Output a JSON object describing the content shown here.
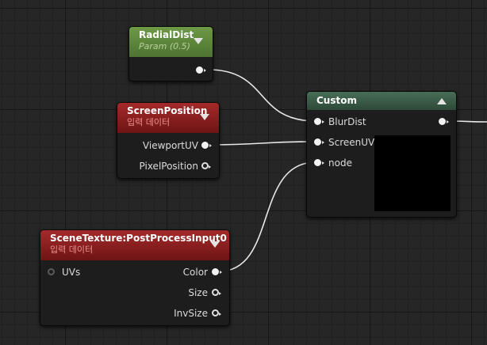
{
  "nodes": {
    "radial_dist": {
      "title": "RadialDist",
      "subtitle": "Param (0.5)"
    },
    "screen_position": {
      "title": "ScreenPosition",
      "subtitle": "입력 데이터",
      "outputs": [
        "ViewportUV",
        "PixelPosition"
      ]
    },
    "custom": {
      "title": "Custom",
      "inputs": [
        "BlurDist",
        "ScreenUV",
        "node"
      ]
    },
    "scene_texture": {
      "title": "SceneTexture:PostProcessInput0",
      "subtitle": "입력 데이터",
      "inputs": [
        "UVs"
      ],
      "outputs": [
        "Color",
        "Size",
        "InvSize"
      ]
    }
  },
  "colors": {
    "canvas": "#262626",
    "param_header": "#5d8a3a",
    "input_header": "#8f1f1f",
    "custom_header": "#3f6a4f",
    "wire": "#f0f0f0"
  }
}
